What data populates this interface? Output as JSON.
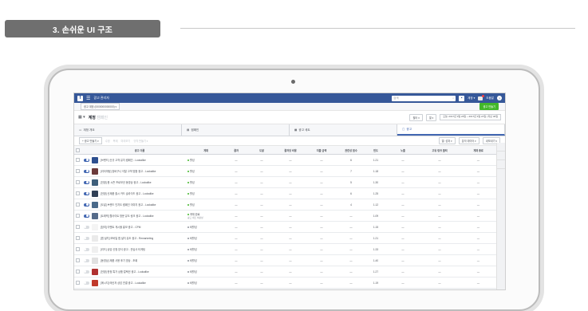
{
  "section": {
    "title": "3. 손쉬운 UI 구조"
  },
  "topbar": {
    "menu_icon": "hamburger-icon",
    "title": "광고 관리자",
    "search_placeholder": "검색",
    "account_btn": "계정 ▾",
    "help_label": "도움말"
  },
  "account_bar": {
    "account": "광고 계정 (0000000000000) ▾",
    "create_button": "광고 만들기"
  },
  "campaign_bar": {
    "prefix": "캠페인:",
    "name": "계정",
    "muted": "캠페인",
    "filter_btn": "필터 ▾",
    "columns_btn": "열 ▾",
    "date_range": "오늘: 2017년 3월 23일 ~ 2017년 4월 21일 | 지난 30일"
  },
  "tabs": [
    {
      "label": "계정 개요",
      "icon": "chart-icon"
    },
    {
      "label": "캠페인",
      "icon": "folder-icon"
    },
    {
      "label": "광고 세트",
      "icon": "grid-icon"
    },
    {
      "label": "광고",
      "icon": "ad-icon"
    }
  ],
  "toolbar": {
    "create": "+ 광고 만들기 ▾",
    "tools": [
      "수정",
      "복제",
      "미리보기",
      "규칙 만들기 ▾"
    ],
    "right": [
      "열: 성과 ▾",
      "분석 데이터 ▾",
      "내보내기 ▾"
    ]
  },
  "table": {
    "headers": [
      "",
      "",
      "광고 이름",
      "게재",
      "결과",
      "도달",
      "결과당 비용",
      "지출 금액",
      "관련성 점수",
      "빈도",
      "노출",
      "고유 링크 클릭",
      "게재 종료"
    ],
    "rows": [
      {
        "on": true,
        "thumb": "#2d4f8f",
        "name": "[브랜드] 신규 고객 유치 캠페인 - Lookalike",
        "status": "활성",
        "status_sub": "",
        "results": "—",
        "reach": "—",
        "cost": "—",
        "spend": "—",
        "rel": "6",
        "freq": "1.21",
        "impr": "—",
        "clicks": "—",
        "end": "—"
      },
      {
        "on": true,
        "thumb": "#6b3a3a",
        "name": "[리타게팅] 장바구니 이탈 고객 맞춤 광고 - Lookalike",
        "status": "활성",
        "status_sub": "",
        "results": "—",
        "reach": "—",
        "cost": "—",
        "spend": "—",
        "rel": "7",
        "freq": "1.18",
        "impr": "—",
        "clicks": "—",
        "end": "—"
      },
      {
        "on": true,
        "thumb": "#3e5e7a",
        "name": "[전환] 봄 시즌 프로모션 동영상 광고 - Lookalike",
        "status": "활성",
        "status_sub": "",
        "results": "—",
        "reach": "—",
        "cost": "—",
        "spend": "—",
        "rel": "5",
        "freq": "1.30",
        "impr": "—",
        "clicks": "—",
        "end": "—"
      },
      {
        "on": true,
        "thumb": "#2f3f55",
        "name": "[전환] 신제품 출시 카드 슬라이드 광고 - Lookalike",
        "status": "활성",
        "status_sub": "",
        "results": "—",
        "reach": "—",
        "cost": "—",
        "spend": "—",
        "rel": "6",
        "freq": "1.25",
        "impr": "—",
        "clicks": "—",
        "end": "—"
      },
      {
        "on": true,
        "thumb": "#4a6a8a",
        "name": "[도달] 브랜드 인지도 캠페인 이미지 광고 - Lookalike",
        "status": "활성",
        "status_sub": "",
        "results": "—",
        "reach": "—",
        "cost": "—",
        "spend": "—",
        "rel": "4",
        "freq": "1.12",
        "impr": "—",
        "clicks": "—",
        "end": "—"
      },
      {
        "on": true,
        "thumb": "#556b8a",
        "name": "[트래픽] 웹사이트 방문 유도 링크 광고 - Lookalike",
        "status": "게재 완료",
        "status_sub": "광고 세트 비활성",
        "results": "—",
        "reach": "—",
        "cost": "—",
        "spend": "—",
        "rel": "—",
        "freq": "1.09",
        "impr": "—",
        "clicks": "—",
        "end": "—"
      },
      {
        "on": false,
        "thumb": "#f4f4f4",
        "name": "[참여] 이벤트 게시물 홍보 광고 - CPM",
        "status": "비활성",
        "status_sub": "",
        "results": "—",
        "reach": "—",
        "cost": "—",
        "spend": "—",
        "rel": "—",
        "freq": "1.15",
        "impr": "—",
        "clicks": "—",
        "end": "—"
      },
      {
        "on": false,
        "thumb": "#eaeaea",
        "name": "[앱 설치] 모바일 앱 설치 유도 광고 - Remarketing",
        "status": "비활성",
        "status_sub": "",
        "results": "—",
        "reach": "—",
        "cost": "—",
        "spend": "—",
        "rel": "—",
        "freq": "1.21",
        "impr": "—",
        "clicks": "—",
        "end": "—"
      },
      {
        "on": false,
        "thumb": "#efefef",
        "name": "[리드] 상담 신청 양식 광고 - 관심사 타게팅",
        "status": "비활성",
        "status_sub": "",
        "results": "—",
        "reach": "—",
        "cost": "—",
        "spend": "—",
        "rel": "—",
        "freq": "1.33",
        "impr": "—",
        "clicks": "—",
        "end": "—"
      },
      {
        "on": false,
        "thumb": "#e0e0e0",
        "name": "[동영상] 제품 사용 후기 영상 - 조회",
        "status": "비활성",
        "status_sub": "",
        "results": "—",
        "reach": "—",
        "cost": "—",
        "spend": "—",
        "rel": "—",
        "freq": "1.40",
        "impr": "—",
        "clicks": "—",
        "end": "—"
      },
      {
        "on": false,
        "thumb": "#b03030",
        "name": "[전환] 한정 특가 상품 컬렉션 광고 - Lookalike",
        "status": "비활성",
        "status_sub": "",
        "results": "—",
        "reach": "—",
        "cost": "—",
        "spend": "—",
        "rel": "—",
        "freq": "1.27",
        "impr": "—",
        "clicks": "—",
        "end": "—"
      },
      {
        "on": false,
        "thumb": "#c0392b",
        "name": "[메시지] 메신저 상담 연결 광고 - Lookalike",
        "status": "비활성",
        "status_sub": "",
        "results": "—",
        "reach": "—",
        "cost": "—",
        "spend": "—",
        "rel": "—",
        "freq": "1.19",
        "impr": "—",
        "clicks": "—",
        "end": "—"
      }
    ],
    "total": {
      "label": "광고 12개 결과",
      "sub": "사용할 기준 계정 제외",
      "freq": "—",
      "impr": "—",
      "clicks": "—",
      "end": "—"
    }
  }
}
